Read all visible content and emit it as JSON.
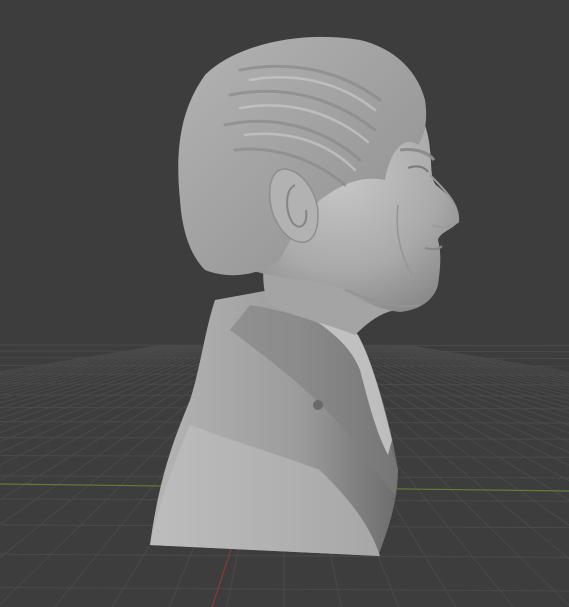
{
  "viewport": {
    "background_color": "#3d3d3d",
    "grid_color": "#4a4a4a",
    "x_axis_color": "#5e7d3a",
    "y_axis_color": "#8a3a3a",
    "model_color": "#b8b8b8",
    "model_subject": "bust-sculpture"
  }
}
